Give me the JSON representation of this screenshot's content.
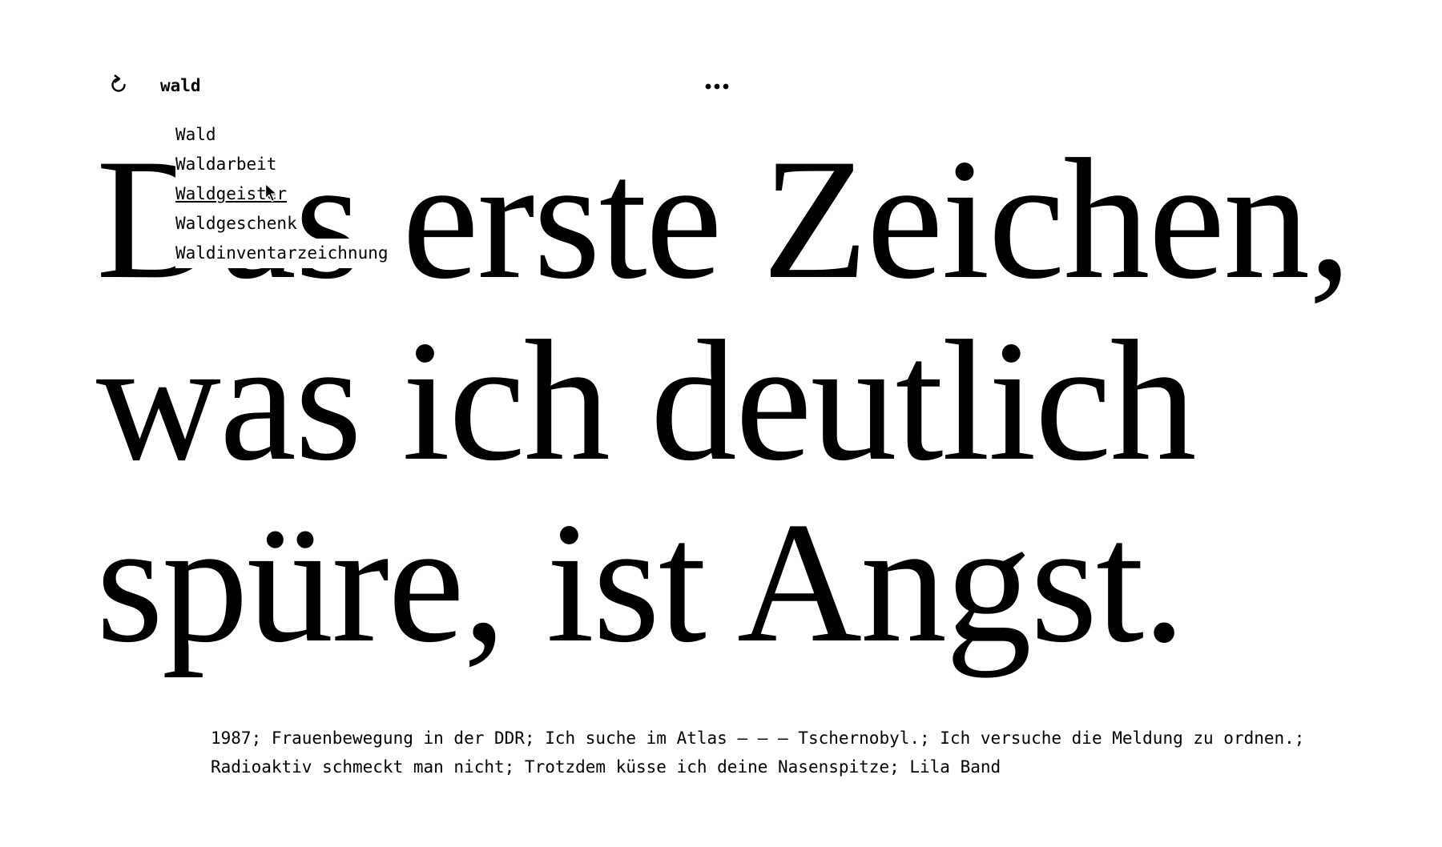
{
  "toolbar": {
    "reload_icon": "reload-icon",
    "more_icon": "more-horizontal-icon"
  },
  "search": {
    "value": "wald",
    "placeholder": ""
  },
  "suggestions": [
    {
      "label": "Wald"
    },
    {
      "label": "Waldarbeit"
    },
    {
      "label": "Waldgeister",
      "hovered": true
    },
    {
      "label": "Waldgeschenk"
    },
    {
      "label": "Waldinventarzeichnung"
    }
  ],
  "headline": {
    "lines": [
      "Das erste Zeichen,",
      "was ich deutlich",
      "spüre, ist Angst."
    ]
  },
  "tags": {
    "line1": "1987; Frauenbewegung in der DDR; Ich suche im Atlas – – – Tschernobyl.; Ich versuche die Meldung zu ordnen.;",
    "line2": "Radioaktiv schmeckt man nicht; Trotzdem küsse ich deine Nasenspitze; Lila Band"
  },
  "colors": {
    "background": "#ffffff",
    "text": "#000000"
  }
}
